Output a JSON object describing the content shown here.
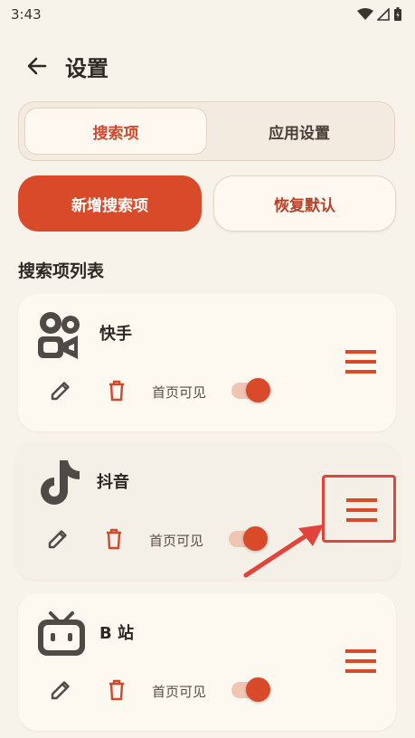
{
  "status": {
    "time": "3:43"
  },
  "appbar": {
    "title": "设置"
  },
  "tabs": [
    {
      "label": "搜索项",
      "active": true
    },
    {
      "label": "应用设置",
      "active": false
    }
  ],
  "actions": {
    "add_label": "新增搜索项",
    "reset_label": "恢复默认"
  },
  "section": {
    "title": "搜索项列表"
  },
  "items": [
    {
      "name": "快手",
      "visible_label": "首页可见",
      "enabled": true,
      "icon": "kuaishou-icon"
    },
    {
      "name": "抖音",
      "visible_label": "首页可见",
      "enabled": true,
      "icon": "douyin-icon"
    },
    {
      "name": "B 站",
      "visible_label": "首页可见",
      "enabled": true,
      "icon": "bilibili-icon"
    }
  ],
  "colors": {
    "accent": "#d94a2a",
    "background": "#f8f3ea",
    "annotation": "#e2443b"
  }
}
